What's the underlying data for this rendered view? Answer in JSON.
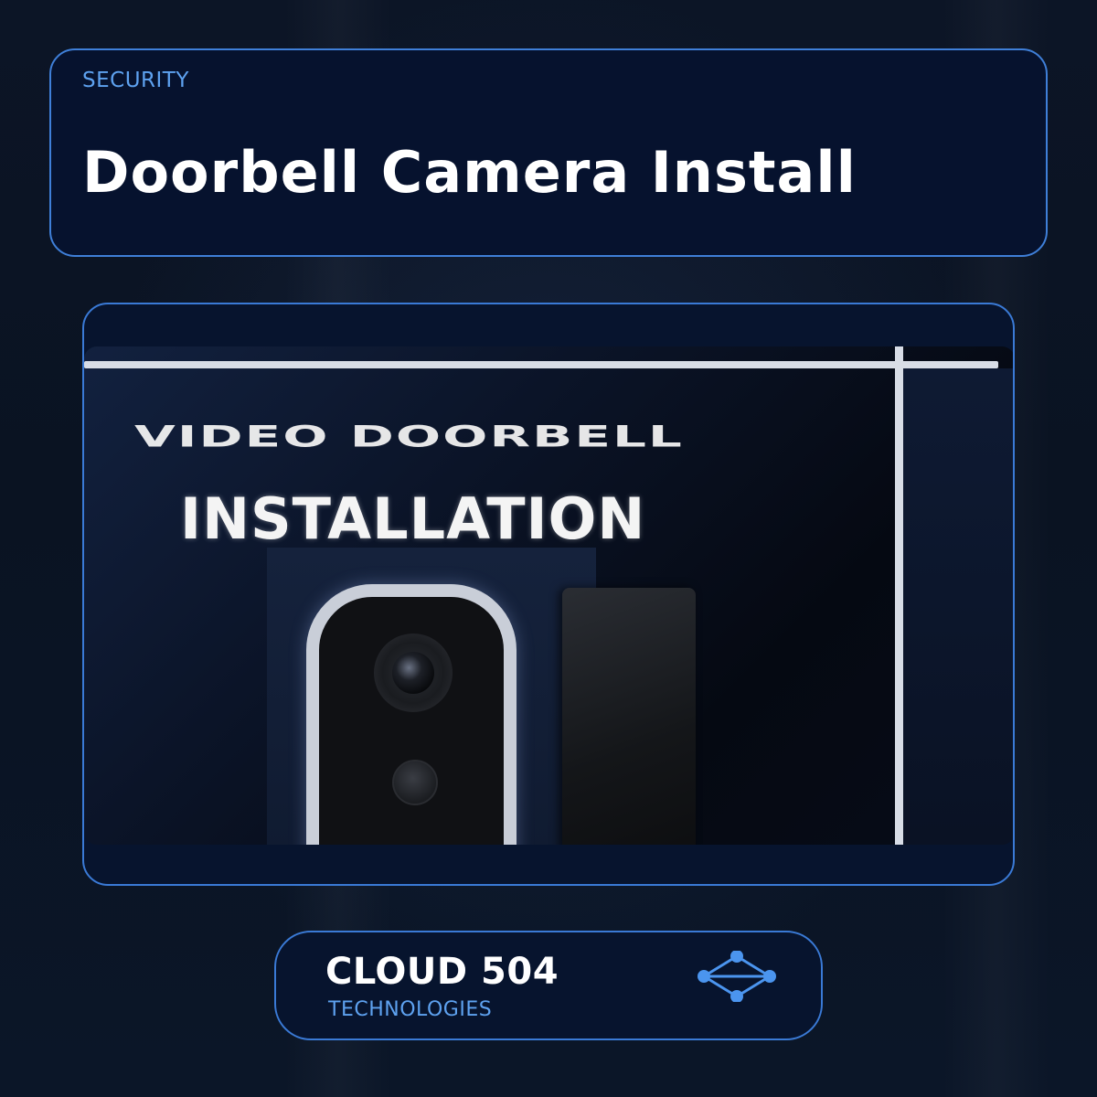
{
  "header": {
    "category": "SECURITY",
    "title": "Doorbell Camera Install"
  },
  "feature_image": {
    "text_line1": "VIDEO DOORBELL",
    "text_line2": "INSTALLATION"
  },
  "brand": {
    "name": "CLOUD 504",
    "tagline": "TECHNOLOGIES",
    "logo_icon": "network-nodes-icon"
  },
  "colors": {
    "accent": "#3f7fd8",
    "accent_text": "#5ea2f0",
    "card_background": "#06122e",
    "page_background": "#0b1526"
  }
}
